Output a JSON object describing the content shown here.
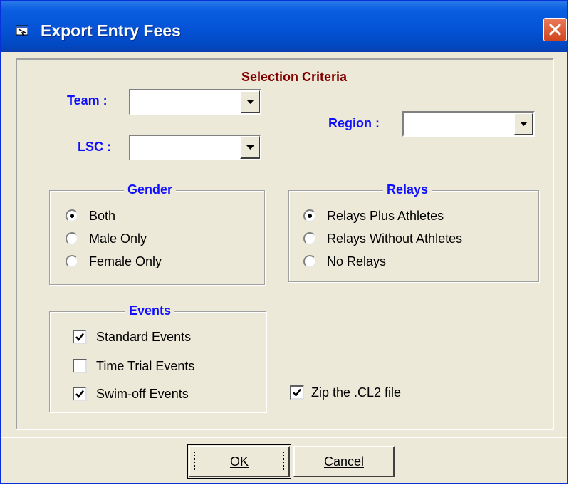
{
  "window": {
    "title": "Export Entry Fees"
  },
  "criteria": {
    "title": "Selection Criteria",
    "team": {
      "label": "Team :",
      "value": ""
    },
    "lsc": {
      "label": "LSC :",
      "value": ""
    },
    "region": {
      "label": "Region :",
      "value": ""
    }
  },
  "gender": {
    "title": "Gender",
    "options": [
      {
        "label": "Both",
        "selected": true
      },
      {
        "label": "Male Only",
        "selected": false
      },
      {
        "label": "Female Only",
        "selected": false
      }
    ]
  },
  "relays": {
    "title": "Relays",
    "options": [
      {
        "label": "Relays Plus Athletes",
        "selected": true
      },
      {
        "label": "Relays Without Athletes",
        "selected": false
      },
      {
        "label": "No Relays",
        "selected": false
      }
    ]
  },
  "events": {
    "title": "Events",
    "options": [
      {
        "label": "Standard Events",
        "checked": true
      },
      {
        "label": "Time Trial Events",
        "checked": false
      },
      {
        "label": "Swim-off Events",
        "checked": true
      }
    ]
  },
  "zip": {
    "label": "Zip the .CL2 file",
    "checked": true
  },
  "buttons": {
    "ok": "OK",
    "cancel": "Cancel"
  },
  "icons": {
    "title": "app-icon",
    "close": "close-icon",
    "dropdown": "chevron-down-icon"
  },
  "colors": {
    "title_bar": "#0553d6",
    "label_blue": "#1010ff",
    "criteria_red": "#800000",
    "close_red": "#d2461e"
  }
}
